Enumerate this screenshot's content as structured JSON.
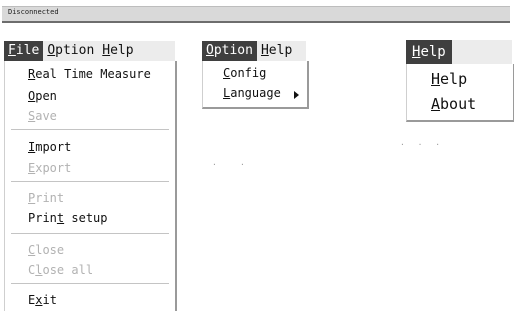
{
  "status": {
    "connection": "Disconnected"
  },
  "menubar1": {
    "file": {
      "hot": "F",
      "rest": "ile"
    },
    "option": {
      "hot": "O",
      "rest": "ption"
    },
    "help": {
      "hot": "H",
      "rest": "elp"
    }
  },
  "file_menu": {
    "real_time_measure": {
      "hot": "R",
      "rest": "eal Time Measure",
      "enabled": true
    },
    "open": {
      "hot": "O",
      "rest": "pen",
      "enabled": true
    },
    "save": {
      "hot": "S",
      "rest": "ave",
      "enabled": false
    },
    "import": {
      "hot": "I",
      "rest": "mport",
      "enabled": true
    },
    "export": {
      "hot": "E",
      "rest": "xport",
      "enabled": false
    },
    "print": {
      "hot": "P",
      "rest": "rint",
      "enabled": false
    },
    "print_setup": {
      "pre": "Prin",
      "hot": "t",
      "rest": " setup",
      "enabled": true
    },
    "close": {
      "hot": "C",
      "rest": "lose",
      "enabled": false
    },
    "close_all": {
      "pre": "C",
      "hot": "l",
      "rest": "ose all",
      "enabled": false
    },
    "exit": {
      "pre": "E",
      "hot": "x",
      "rest": "it",
      "enabled": true
    }
  },
  "menubar2": {
    "option": {
      "hot": "O",
      "rest": "ption"
    },
    "help": {
      "hot": "H",
      "rest": "elp"
    }
  },
  "option_menu": {
    "config": {
      "hot": "C",
      "rest": "onfig"
    },
    "language": {
      "hot": "L",
      "rest": "anguage",
      "has_submenu": true
    }
  },
  "menubar3": {
    "help": {
      "hot": "H",
      "rest": "elp"
    }
  },
  "help_menu": {
    "help": {
      "hot": "H",
      "rest": "elp"
    },
    "about": {
      "hot": "A",
      "rest": "bout"
    }
  }
}
